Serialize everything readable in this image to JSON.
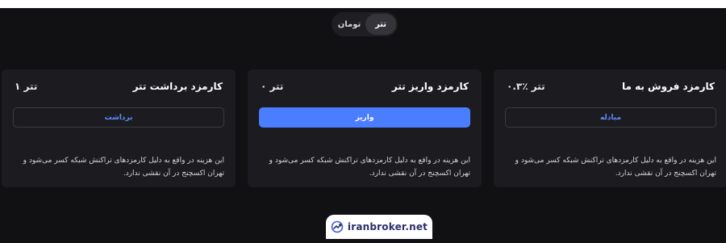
{
  "toggle": {
    "toman_label": "تومان",
    "tether_label": "تتر"
  },
  "cards": [
    {
      "title": "کارمزد فروش به ما",
      "fee": "۰.۳٪ تتر",
      "button": "مبادله",
      "description": "این هزینه در واقع به دلیل کارمزدهای تراکنش شبکه کسر می‌شود و تهران اکسچنج در آن نقشی ندارد."
    },
    {
      "title": "کارمزد واریز تتر",
      "fee": "۰ تتر",
      "button": "واریز",
      "description": "این هزینه در واقع به دلیل کارمزدهای تراکنش شبکه کسر می‌شود و تهران اکسچنج در آن نقشی ندارد."
    },
    {
      "title": "کارمزد برداشت تتر",
      "fee": "۱ تتر",
      "button": "برداشت",
      "description": "این هزینه در واقع به دلیل کارمزدهای تراکنش شبکه کسر می‌شود و تهران اکسچنج در آن نقشی ندارد."
    }
  ],
  "watermark": {
    "text": "iranbroker.net",
    "icon": "chart-trend-icon"
  },
  "colors": {
    "accent": "#4a7dff",
    "background": "#111113",
    "card": "#1c1c20"
  }
}
